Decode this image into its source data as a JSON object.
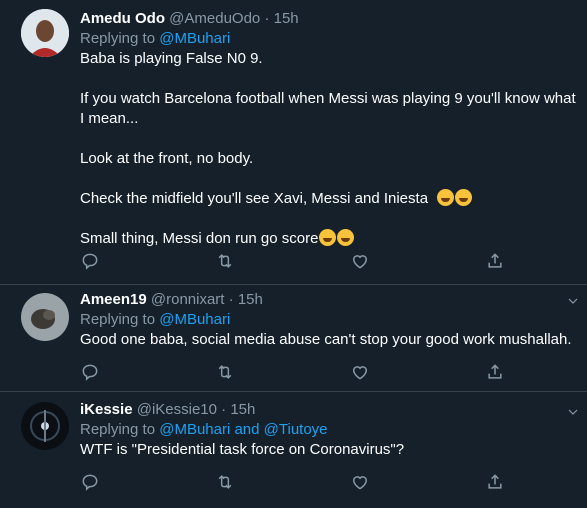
{
  "tweets": [
    {
      "name": "Amedu Odo",
      "handle": "@AmeduOdo",
      "sep": "·",
      "time": "15h",
      "replying_prefix": "Replying to",
      "replying_to": "@MBuhari",
      "lines": [
        "Baba is playing False N0 9.",
        "If you watch Barcelona football when Messi was playing 9 you'll know what I mean...",
        "Look at the front, no body.",
        "Check the midfield you'll see Xavi, Messi and Iniesta",
        "Small thing, Messi don run go score"
      ]
    },
    {
      "name": "Ameen19",
      "handle": "@ronnixart",
      "sep": "·",
      "time": "15h",
      "replying_prefix": "Replying to",
      "replying_to": "@MBuhari",
      "lines": [
        "Good one baba, social media abuse can't stop your good work mushallah."
      ]
    },
    {
      "name": "iKessie",
      "handle": "@iKessie10",
      "sep": "·",
      "time": "15h",
      "replying_prefix": "Replying to",
      "replying_to": "@MBuhari and @Tiutoye",
      "lines": [
        "WTF is \"Presidential task force on Coronavirus\"?"
      ]
    }
  ],
  "icons": [
    "reply-icon",
    "retweet-icon",
    "like-icon",
    "share-icon",
    "chevron-down-icon"
  ],
  "colors": {
    "background": "#15202b",
    "muted": "#8899a6",
    "link": "#1da1f2",
    "border": "#38444d"
  }
}
